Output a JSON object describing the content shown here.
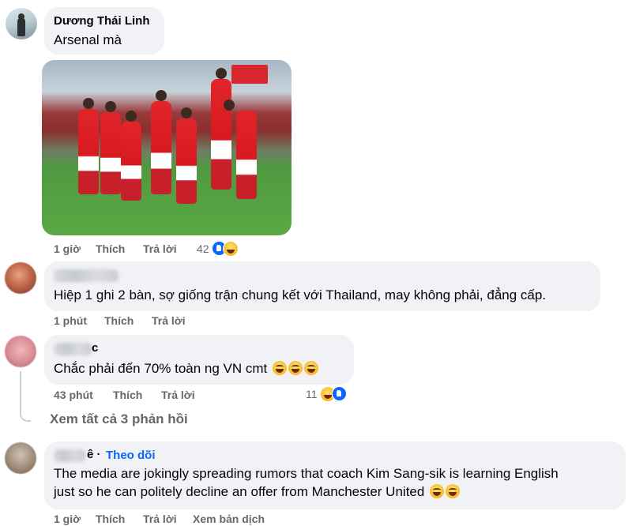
{
  "comments": [
    {
      "author": "Dương Thái Linh",
      "text": "Arsenal mà",
      "time": "1 giờ",
      "like": "Thích",
      "reply": "Trả lời",
      "reaction_count": "42"
    },
    {
      "author_suffix": "",
      "text": "Hiệp 1 ghi 2 bàn, sợ giống trận chung kết với Thailand, may không phải, đẳng cấp.",
      "time": "1 phút",
      "like": "Thích",
      "reply": "Trả lời"
    },
    {
      "author_suffix": "c",
      "text": "Chắc phải đến 70% toàn ng VN cmt",
      "time": "43 phút",
      "like": "Thích",
      "reply": "Trả lời",
      "reaction_count": "11"
    },
    {
      "author_suffix": "ê ·",
      "follow": "Theo dõi",
      "text_line1": "The media are jokingly spreading rumors that coach Kim Sang-sik is learning English",
      "text_line2": "just so he can politely decline an offer from Manchester United",
      "time": "1 giờ",
      "like": "Thích",
      "reply": "Trả lời",
      "translate": "Xem bản dịch"
    }
  ],
  "view_replies": "Xem tất cả 3 phản hồi",
  "icons": {
    "like": "like-reaction-icon",
    "haha": "haha-reaction-icon",
    "laugh_emoji": "face-with-tears-of-joy"
  },
  "colors": {
    "bubble": "#f0f2f5",
    "meta": "#65676b",
    "link_blue": "#0866ff"
  }
}
